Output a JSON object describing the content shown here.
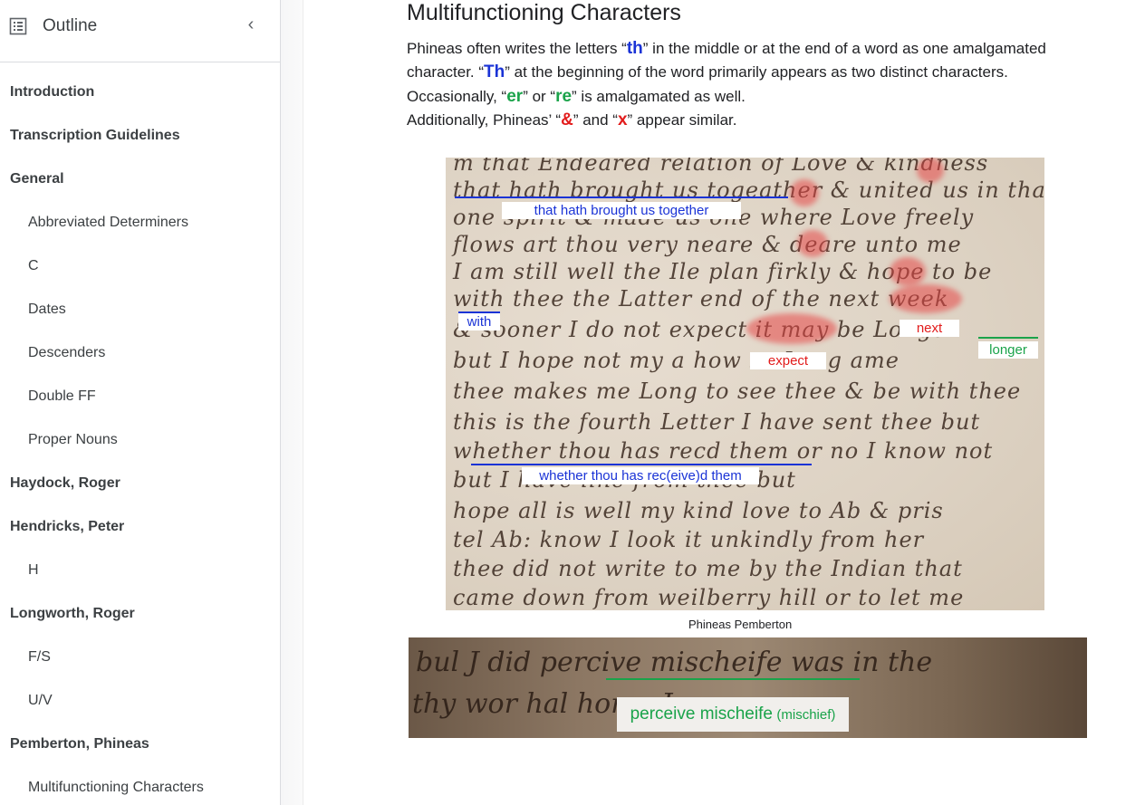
{
  "sidebar": {
    "title": "Outline",
    "items": [
      {
        "label": "Introduction",
        "level": 1
      },
      {
        "label": "Transcription Guidelines",
        "level": 1
      },
      {
        "label": "General",
        "level": 1
      },
      {
        "label": "Abbreviated Determiners",
        "level": 2
      },
      {
        "label": "C",
        "level": 2
      },
      {
        "label": "Dates",
        "level": 2
      },
      {
        "label": "Descenders",
        "level": 2
      },
      {
        "label": "Double FF",
        "level": 2
      },
      {
        "label": "Proper Nouns",
        "level": 2
      },
      {
        "label": "Haydock, Roger",
        "level": 1
      },
      {
        "label": "Hendricks, Peter",
        "level": 1
      },
      {
        "label": "H",
        "level": 2
      },
      {
        "label": "Longworth, Roger",
        "level": 1
      },
      {
        "label": "F/S",
        "level": 2
      },
      {
        "label": "U/V",
        "level": 2
      },
      {
        "label": "Pemberton, Phineas",
        "level": 1
      },
      {
        "label": "Multifunctioning Characters",
        "level": 2
      }
    ]
  },
  "main": {
    "heading": "Multifunctioning Characters",
    "p1": {
      "a": "Phineas often writes the letters “",
      "th": "th",
      "b": "” in the middle or at the end of a word as one amalgamated"
    },
    "p2": {
      "a": "character. “",
      "Th": "Th",
      "b": "” at the beginning of the word primarily appears as two distinct characters."
    },
    "p3": {
      "a": "Occasionally, “",
      "er": "er",
      "b": "” or “",
      "re": "re",
      "c": "” is amalgamated as well."
    },
    "p4": {
      "a": "Additionally, Phineas’ “",
      "amp": "&",
      "b": "” and “",
      "x": "x",
      "c": "” appear similar."
    },
    "annotations": {
      "that_hath": "that hath brought us together",
      "with": "with",
      "next": "next",
      "longer": "longer",
      "expect": "expect",
      "whether": "whether thou has rec(eive)d them"
    },
    "caption": "Phineas Pemberton",
    "strip": {
      "main": "perceive mischeife",
      "sub": "(mischief)"
    }
  },
  "colors": {
    "blue": "#1a33d6",
    "green": "#1aa34a",
    "red": "#e21c1c"
  }
}
